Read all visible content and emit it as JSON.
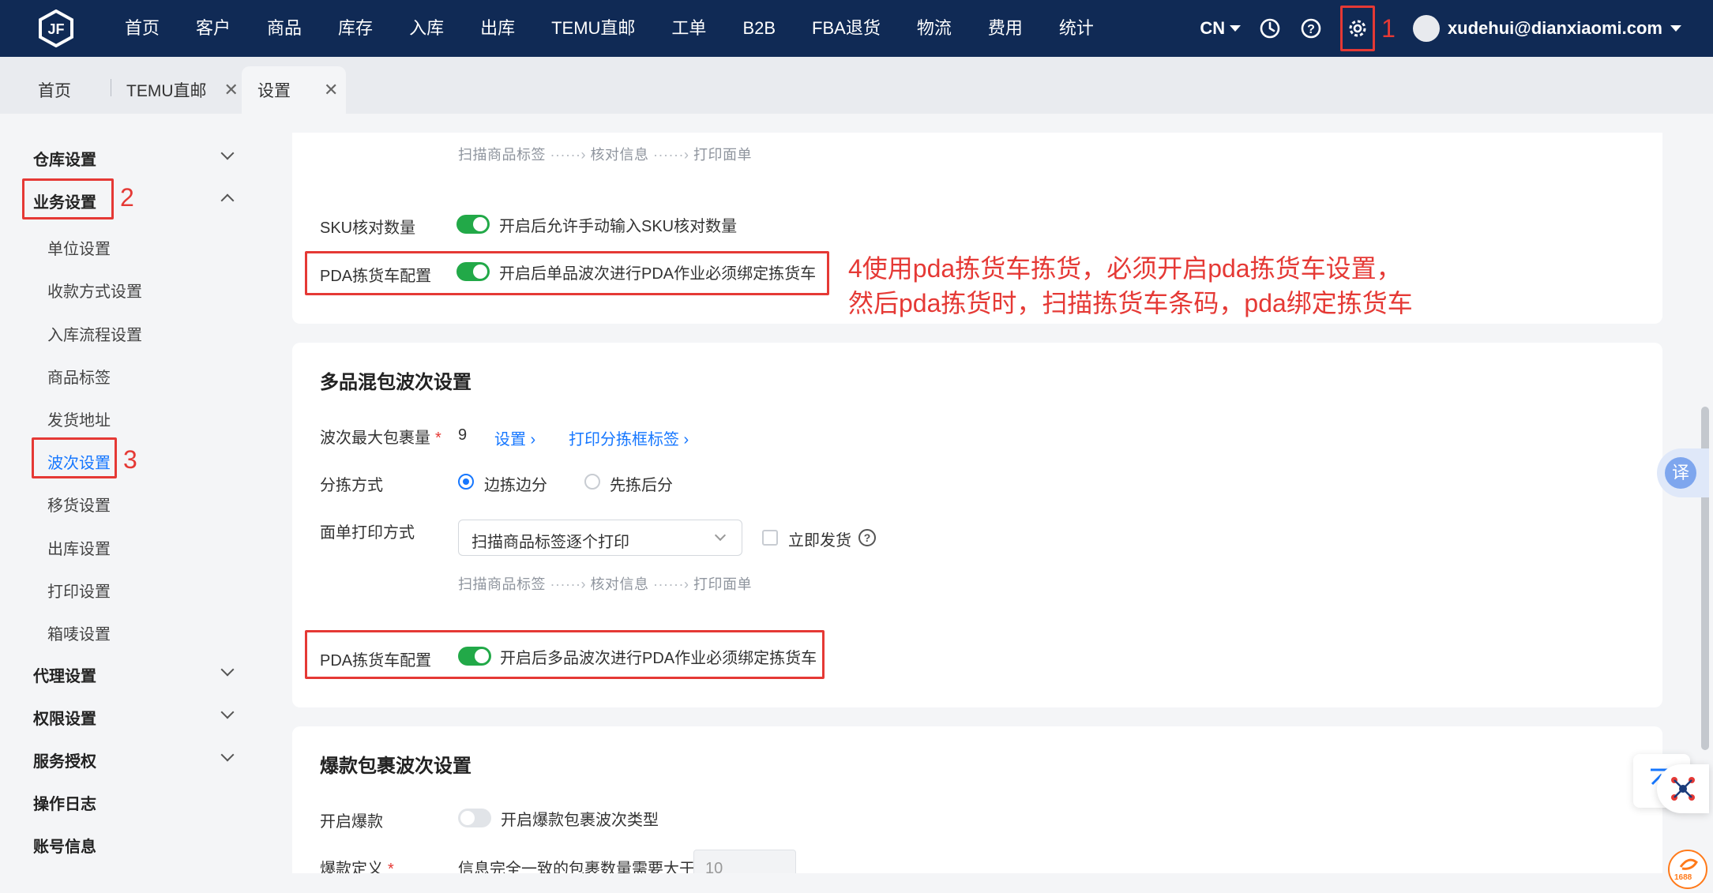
{
  "nav": {
    "items": [
      "首页",
      "客户",
      "商品",
      "库存",
      "入库",
      "出库",
      "TEMU直邮",
      "工单",
      "B2B",
      "FBA退货",
      "物流",
      "费用",
      "统计"
    ],
    "lang": "CN",
    "user_email": "xudehui@dianxiaomi.com",
    "accent": "#102a55"
  },
  "tabs": [
    {
      "label": "首页"
    },
    {
      "label": "TEMU直邮",
      "close": "✕"
    },
    {
      "label": "设置",
      "close": "✕"
    }
  ],
  "sidebar": {
    "groups": {
      "warehouse": "仓库设置",
      "business": "业务设置",
      "agent": "代理设置",
      "permission": "权限设置",
      "service": "服务授权",
      "log": "操作日志",
      "account": "账号信息"
    },
    "business_items": [
      "单位设置",
      "收款方式设置",
      "入库流程设置",
      "商品标签",
      "发货地址",
      "波次设置",
      "移货设置",
      "出库设置",
      "打印设置",
      "箱唛设置"
    ],
    "active_item": "波次设置"
  },
  "section1": {
    "flow": [
      "扫描商品标签",
      "核对信息",
      "打印面单"
    ],
    "sku_label": "SKU核对数量",
    "sku_text": "开启后允许手动输入SKU核对数量",
    "pda_label": "PDA拣货车配置",
    "pda_text": "开启后单品波次进行PDA作业必须绑定拣货车"
  },
  "section2": {
    "title": "多品混包波次设置",
    "max_label": "波次最大包裹量",
    "max_value": "9",
    "link_set": "设置",
    "link_print": "打印分拣框标签",
    "sort_label": "分拣方式",
    "sort_opt1": "边拣边分",
    "sort_opt2": "先拣后分",
    "print_label": "面单打印方式",
    "print_value": "扫描商品标签逐个打印",
    "ship_now": "立即发货",
    "flow": [
      "扫描商品标签",
      "核对信息",
      "打印面单"
    ],
    "pda_label": "PDA拣货车配置",
    "pda_text": "开启后多品波次进行PDA作业必须绑定拣货车"
  },
  "section3": {
    "title": "爆款包裹波次设置",
    "enable_label": "开启爆款",
    "enable_text": "开启爆款包裹波次类型",
    "define_label": "爆款定义",
    "define_text": "信息完全一致的包裹数量需要大于",
    "define_value": "10"
  },
  "annotations": {
    "n1": "1",
    "n2": "2",
    "n3": "3",
    "note_line1": "4使用pda拣货车拣货，必须开启pda拣货车设置，",
    "note_line2": "然后pda拣货时，扫描拣货车条码，pda绑定拣货车",
    "color": "#e53935"
  },
  "floating": {
    "translate": "译",
    "badge": "1688"
  }
}
